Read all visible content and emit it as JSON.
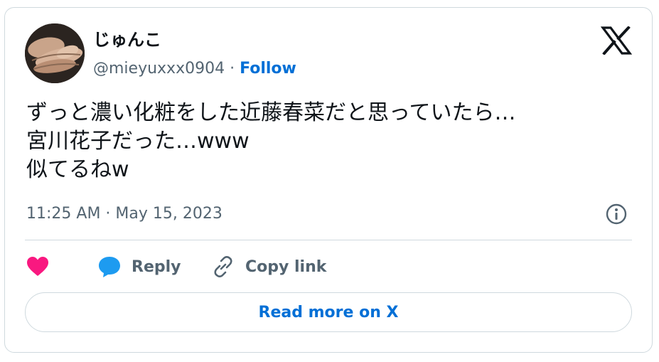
{
  "author": {
    "display_name": "じゅんこ",
    "handle": "@mieyuxxx0904",
    "separator": " · ",
    "follow_label": "Follow"
  },
  "brand": {
    "logo_icon": "x-logo-icon"
  },
  "tweet": {
    "lines": [
      "ずっと濃い化粧をした近藤春菜だと思っていたら…",
      "宮川花子だった…www",
      "似てるねw"
    ],
    "timestamp": "11:25 AM · May 15, 2023"
  },
  "actions": {
    "like_icon": "heart-icon",
    "reply_icon": "speech-bubble-icon",
    "reply_label": "Reply",
    "copy_icon": "link-icon",
    "copy_label": "Copy link"
  },
  "read_more_label": "Read more on X",
  "colors": {
    "accent": "#006fd6",
    "like": "#f91880",
    "reply": "#1d9bf0",
    "text": "#0f1419",
    "muted": "#536471",
    "border": "#cfd9de"
  }
}
